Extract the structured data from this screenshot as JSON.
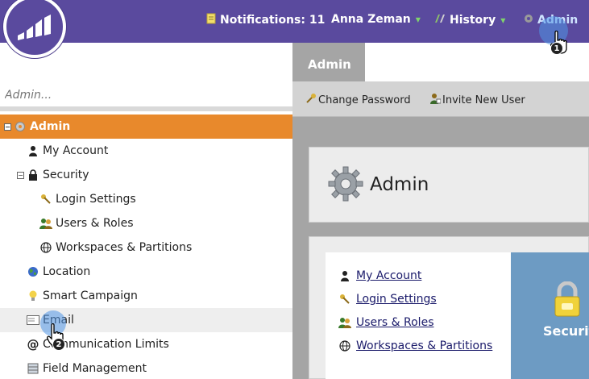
{
  "topbar": {
    "notifications_label": "Notifications: 11",
    "user_label": "Anna Zeman",
    "history_label": "History",
    "admin_label": "Admin",
    "bg_color": "#5a4a9e"
  },
  "sidebar": {
    "search_placeholder": "Admin...",
    "items": [
      {
        "label": "Admin",
        "icon": "gear-icon"
      },
      {
        "label": "My Account",
        "icon": "person-icon"
      },
      {
        "label": "Security",
        "icon": "lock-icon"
      },
      {
        "label": "Login Settings",
        "icon": "keys-icon"
      },
      {
        "label": "Users & Roles",
        "icon": "users-icon"
      },
      {
        "label": "Workspaces & Partitions",
        "icon": "globe-icon"
      },
      {
        "label": "Location",
        "icon": "earth-icon"
      },
      {
        "label": "Smart Campaign",
        "icon": "lightbulb-icon"
      },
      {
        "label": "Email",
        "icon": "email-icon"
      },
      {
        "label": "Communication Limits",
        "icon": "at-icon"
      },
      {
        "label": "Field Management",
        "icon": "field-icon"
      }
    ],
    "selected_color": "#e8892c"
  },
  "main": {
    "tab_label": "Admin",
    "toolbar": {
      "change_password": "Change Password",
      "invite_user": "Invite New User"
    },
    "header_title": "Admin",
    "links": [
      "My Account",
      "Login Settings",
      "Users & Roles",
      "Workspaces & Partitions"
    ],
    "tile_label": "Security"
  },
  "cursors": [
    {
      "step": "1"
    },
    {
      "step": "2"
    }
  ]
}
